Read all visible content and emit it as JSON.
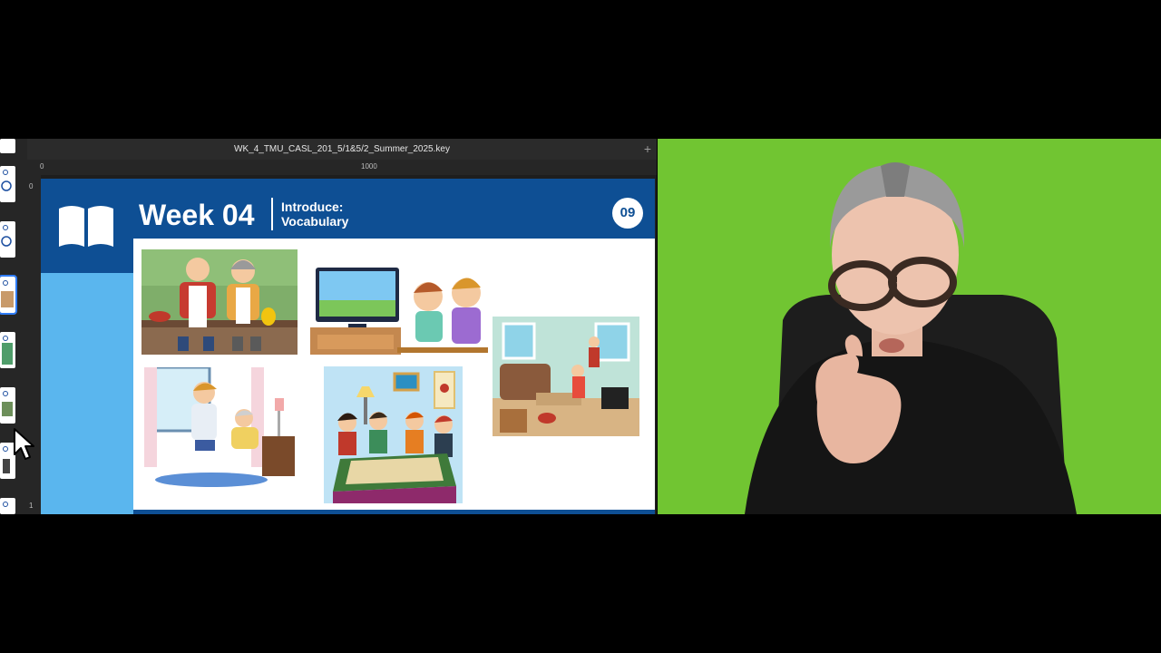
{
  "window": {
    "title": "WK_4_TMU_CASL_201_5/1&5/2_Summer_2025.key"
  },
  "ruler": {
    "marks": [
      "0",
      "1000"
    ]
  },
  "vruler": {
    "marks": [
      "0",
      "1"
    ]
  },
  "slide": {
    "week_label": "Week 04",
    "topic_line1": "Introduce:",
    "topic_line2": "Vocabulary",
    "slide_number": "09"
  },
  "colors": {
    "slide_blue": "#0e4f94",
    "slide_light_blue": "#5ab6ee",
    "green_screen": "#6bbf2f"
  },
  "icons": [
    "book-icon",
    "plus-icon",
    "cursor-icon"
  ]
}
